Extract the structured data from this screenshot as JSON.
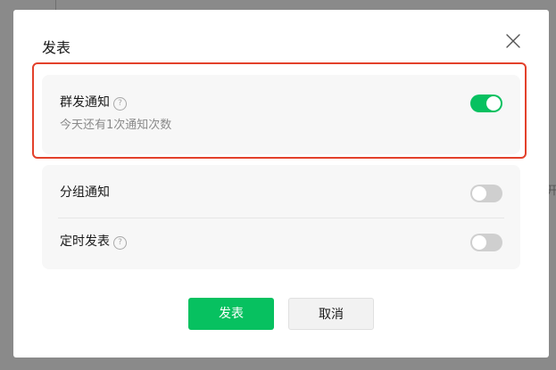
{
  "dialog": {
    "title": "发表",
    "close_icon": "close-icon"
  },
  "broadcast": {
    "label": "群发通知",
    "help_icon": "question-circle-icon",
    "help_glyph": "?",
    "subtext": "今天还有1次通知次数",
    "toggle_state": "on"
  },
  "options": {
    "group_notify": {
      "label": "分组通知",
      "toggle_state": "off"
    },
    "scheduled_publish": {
      "label": "定时发表",
      "help_icon": "question-circle-icon",
      "help_glyph": "?",
      "toggle_state": "off"
    }
  },
  "buttons": {
    "publish_label": "发表",
    "cancel_label": "取消"
  },
  "colors": {
    "accent": "#07c160",
    "highlight_border": "#e3412b",
    "card_bg": "#f7f7f7",
    "toggle_off": "#cfcfcf"
  }
}
